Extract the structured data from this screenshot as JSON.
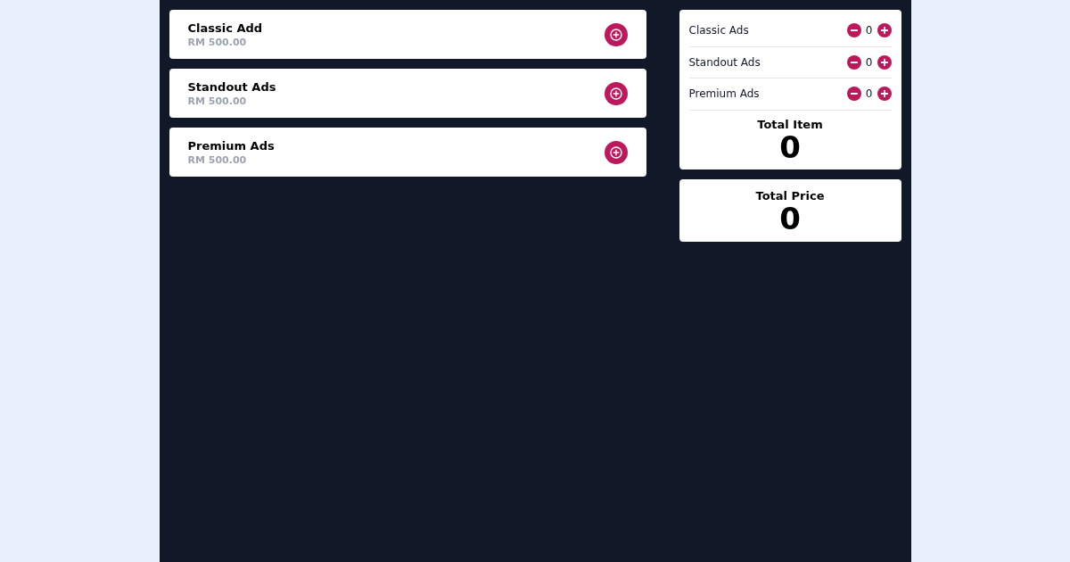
{
  "products": [
    {
      "name": "Classic Add",
      "price": "RM 500.00"
    },
    {
      "name": "Standout Ads",
      "price": "RM 500.00"
    },
    {
      "name": "Premium Ads",
      "price": "RM 500.00"
    }
  ],
  "cart": {
    "items": [
      {
        "name": "Classic Ads",
        "count": "0"
      },
      {
        "name": "Standout Ads",
        "count": "0"
      },
      {
        "name": "Premium Ads",
        "count": "0"
      }
    ],
    "total_item": {
      "label": "Total Item",
      "value": "0"
    }
  },
  "total_price": {
    "label": "Total Price",
    "value": "0"
  }
}
